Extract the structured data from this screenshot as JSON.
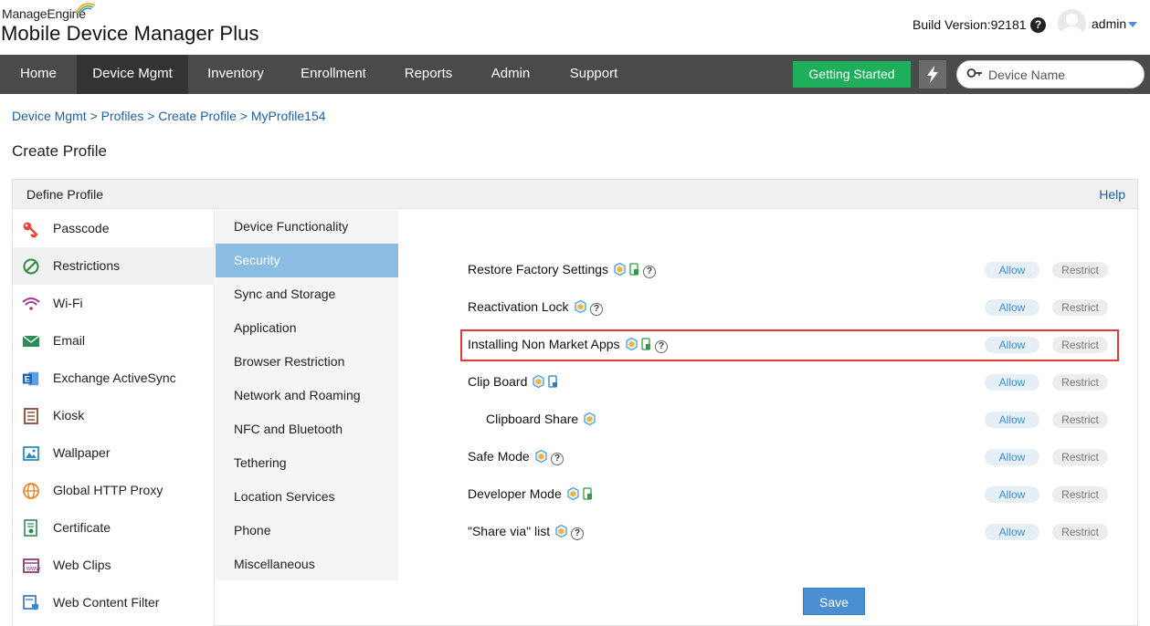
{
  "header": {
    "brand_top": "ManageEngine",
    "brand_main": "Mobile Device Manager Plus",
    "build_version": "Build Version:92181",
    "user": "admin"
  },
  "nav": {
    "items": [
      "Home",
      "Device Mgmt",
      "Inventory",
      "Enrollment",
      "Reports",
      "Admin",
      "Support"
    ],
    "active": "Device Mgmt",
    "getting_started": "Getting Started",
    "search_placeholder": "Device Name"
  },
  "breadcrumb": "Device Mgmt > Profiles > Create Profile > MyProfile154",
  "page_title": "Create Profile",
  "panel": {
    "title": "Define Profile",
    "help": "Help"
  },
  "sidebar": {
    "items": [
      {
        "label": "Passcode",
        "icon": "key-icon"
      },
      {
        "label": "Restrictions",
        "icon": "restriction-icon"
      },
      {
        "label": "Wi-Fi",
        "icon": "wifi-icon"
      },
      {
        "label": "Email",
        "icon": "email-icon"
      },
      {
        "label": "Exchange ActiveSync",
        "icon": "exchange-icon"
      },
      {
        "label": "Kiosk",
        "icon": "kiosk-icon"
      },
      {
        "label": "Wallpaper",
        "icon": "wallpaper-icon"
      },
      {
        "label": "Global HTTP Proxy",
        "icon": "globe-icon"
      },
      {
        "label": "Certificate",
        "icon": "certificate-icon"
      },
      {
        "label": "Web Clips",
        "icon": "webclip-icon"
      },
      {
        "label": "Web Content Filter",
        "icon": "web-filter-icon"
      }
    ],
    "active": "Restrictions"
  },
  "categories": {
    "items": [
      "Device Functionality",
      "Security",
      "Sync and Storage",
      "Application",
      "Browser Restriction",
      "Network and Roaming",
      "NFC and Bluetooth",
      "Tethering",
      "Location Services",
      "Phone",
      "Miscellaneous"
    ],
    "active": "Security"
  },
  "restrictions": [
    {
      "label": "Restore Factory Settings",
      "icons": [
        "samsung-icon",
        "android-device-icon",
        "help-icon"
      ]
    },
    {
      "label": "Reactivation Lock",
      "icons": [
        "samsung-icon",
        "help-icon"
      ]
    },
    {
      "label": "Installing Non Market Apps",
      "icons": [
        "samsung-icon",
        "android-device-icon",
        "help-icon"
      ]
    },
    {
      "label": "Clip Board",
      "icons": [
        "samsung-icon",
        "device-lock-icon"
      ]
    },
    {
      "label": "Clipboard Share",
      "icons": [
        "samsung-icon"
      ]
    },
    {
      "label": "Safe Mode",
      "icons": [
        "samsung-icon",
        "help-icon"
      ]
    },
    {
      "label": "Developer Mode",
      "icons": [
        "samsung-icon",
        "android-device-icon"
      ]
    },
    {
      "label": "\"Share via\" list",
      "icons": [
        "samsung-icon",
        "help-icon"
      ]
    }
  ],
  "buttons": {
    "allow": "Allow",
    "restrict": "Restrict",
    "save": "Save"
  },
  "colors": {
    "nav_bg": "#4a4a4a",
    "getting_started": "#1fae5b",
    "active_category": "#8bbde3",
    "link": "#1f5fa8",
    "highlight": "#e53935"
  }
}
